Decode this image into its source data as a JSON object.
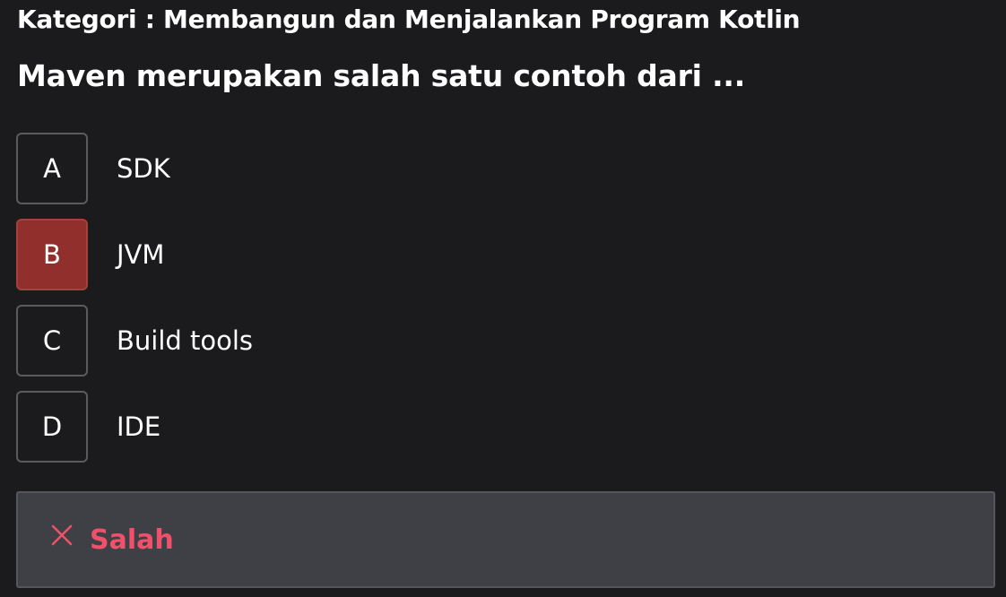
{
  "category": "Kategori : Membangun dan Menjalankan Program Kotlin",
  "question": "Maven merupakan salah satu contoh dari ...",
  "options": [
    {
      "letter": "A",
      "text": "SDK",
      "state": "default"
    },
    {
      "letter": "B",
      "text": "JVM",
      "state": "selected-wrong"
    },
    {
      "letter": "C",
      "text": "Build tools",
      "state": "default"
    },
    {
      "letter": "D",
      "text": "IDE",
      "state": "default"
    }
  ],
  "feedback": {
    "icon": "close-icon",
    "text": "Salah",
    "color": "#f0506a"
  },
  "colors": {
    "background": "#1b1b1d",
    "selected_wrong": "#912f2d",
    "feedback_bg": "#3f4045"
  }
}
